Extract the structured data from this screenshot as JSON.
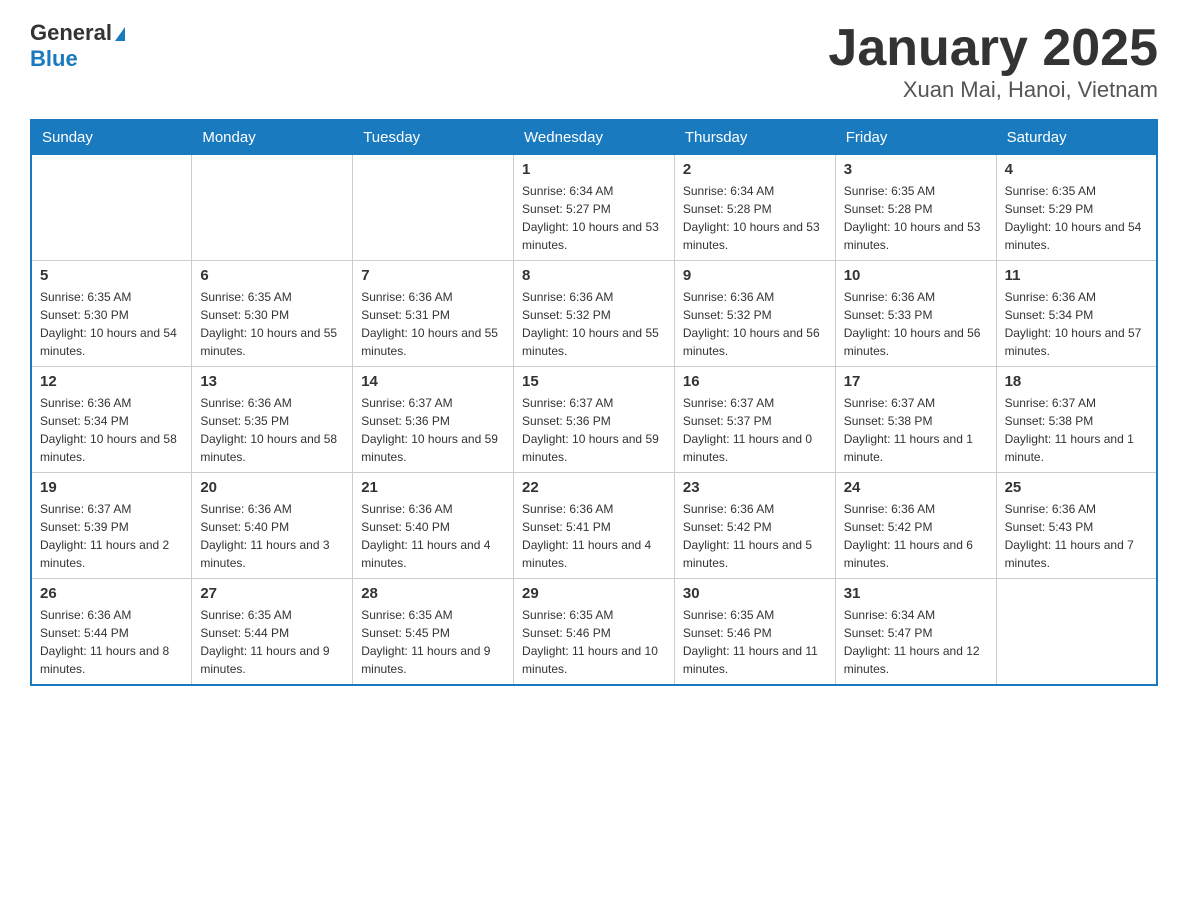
{
  "header": {
    "logo_general": "General",
    "logo_blue": "Blue",
    "title": "January 2025",
    "subtitle": "Xuan Mai, Hanoi, Vietnam"
  },
  "days_of_week": [
    "Sunday",
    "Monday",
    "Tuesday",
    "Wednesday",
    "Thursday",
    "Friday",
    "Saturday"
  ],
  "weeks": [
    {
      "days": [
        {
          "number": "",
          "info": ""
        },
        {
          "number": "",
          "info": ""
        },
        {
          "number": "",
          "info": ""
        },
        {
          "number": "1",
          "info": "Sunrise: 6:34 AM\nSunset: 5:27 PM\nDaylight: 10 hours and 53 minutes."
        },
        {
          "number": "2",
          "info": "Sunrise: 6:34 AM\nSunset: 5:28 PM\nDaylight: 10 hours and 53 minutes."
        },
        {
          "number": "3",
          "info": "Sunrise: 6:35 AM\nSunset: 5:28 PM\nDaylight: 10 hours and 53 minutes."
        },
        {
          "number": "4",
          "info": "Sunrise: 6:35 AM\nSunset: 5:29 PM\nDaylight: 10 hours and 54 minutes."
        }
      ]
    },
    {
      "days": [
        {
          "number": "5",
          "info": "Sunrise: 6:35 AM\nSunset: 5:30 PM\nDaylight: 10 hours and 54 minutes."
        },
        {
          "number": "6",
          "info": "Sunrise: 6:35 AM\nSunset: 5:30 PM\nDaylight: 10 hours and 55 minutes."
        },
        {
          "number": "7",
          "info": "Sunrise: 6:36 AM\nSunset: 5:31 PM\nDaylight: 10 hours and 55 minutes."
        },
        {
          "number": "8",
          "info": "Sunrise: 6:36 AM\nSunset: 5:32 PM\nDaylight: 10 hours and 55 minutes."
        },
        {
          "number": "9",
          "info": "Sunrise: 6:36 AM\nSunset: 5:32 PM\nDaylight: 10 hours and 56 minutes."
        },
        {
          "number": "10",
          "info": "Sunrise: 6:36 AM\nSunset: 5:33 PM\nDaylight: 10 hours and 56 minutes."
        },
        {
          "number": "11",
          "info": "Sunrise: 6:36 AM\nSunset: 5:34 PM\nDaylight: 10 hours and 57 minutes."
        }
      ]
    },
    {
      "days": [
        {
          "number": "12",
          "info": "Sunrise: 6:36 AM\nSunset: 5:34 PM\nDaylight: 10 hours and 58 minutes."
        },
        {
          "number": "13",
          "info": "Sunrise: 6:36 AM\nSunset: 5:35 PM\nDaylight: 10 hours and 58 minutes."
        },
        {
          "number": "14",
          "info": "Sunrise: 6:37 AM\nSunset: 5:36 PM\nDaylight: 10 hours and 59 minutes."
        },
        {
          "number": "15",
          "info": "Sunrise: 6:37 AM\nSunset: 5:36 PM\nDaylight: 10 hours and 59 minutes."
        },
        {
          "number": "16",
          "info": "Sunrise: 6:37 AM\nSunset: 5:37 PM\nDaylight: 11 hours and 0 minutes."
        },
        {
          "number": "17",
          "info": "Sunrise: 6:37 AM\nSunset: 5:38 PM\nDaylight: 11 hours and 1 minute."
        },
        {
          "number": "18",
          "info": "Sunrise: 6:37 AM\nSunset: 5:38 PM\nDaylight: 11 hours and 1 minute."
        }
      ]
    },
    {
      "days": [
        {
          "number": "19",
          "info": "Sunrise: 6:37 AM\nSunset: 5:39 PM\nDaylight: 11 hours and 2 minutes."
        },
        {
          "number": "20",
          "info": "Sunrise: 6:36 AM\nSunset: 5:40 PM\nDaylight: 11 hours and 3 minutes."
        },
        {
          "number": "21",
          "info": "Sunrise: 6:36 AM\nSunset: 5:40 PM\nDaylight: 11 hours and 4 minutes."
        },
        {
          "number": "22",
          "info": "Sunrise: 6:36 AM\nSunset: 5:41 PM\nDaylight: 11 hours and 4 minutes."
        },
        {
          "number": "23",
          "info": "Sunrise: 6:36 AM\nSunset: 5:42 PM\nDaylight: 11 hours and 5 minutes."
        },
        {
          "number": "24",
          "info": "Sunrise: 6:36 AM\nSunset: 5:42 PM\nDaylight: 11 hours and 6 minutes."
        },
        {
          "number": "25",
          "info": "Sunrise: 6:36 AM\nSunset: 5:43 PM\nDaylight: 11 hours and 7 minutes."
        }
      ]
    },
    {
      "days": [
        {
          "number": "26",
          "info": "Sunrise: 6:36 AM\nSunset: 5:44 PM\nDaylight: 11 hours and 8 minutes."
        },
        {
          "number": "27",
          "info": "Sunrise: 6:35 AM\nSunset: 5:44 PM\nDaylight: 11 hours and 9 minutes."
        },
        {
          "number": "28",
          "info": "Sunrise: 6:35 AM\nSunset: 5:45 PM\nDaylight: 11 hours and 9 minutes."
        },
        {
          "number": "29",
          "info": "Sunrise: 6:35 AM\nSunset: 5:46 PM\nDaylight: 11 hours and 10 minutes."
        },
        {
          "number": "30",
          "info": "Sunrise: 6:35 AM\nSunset: 5:46 PM\nDaylight: 11 hours and 11 minutes."
        },
        {
          "number": "31",
          "info": "Sunrise: 6:34 AM\nSunset: 5:47 PM\nDaylight: 11 hours and 12 minutes."
        },
        {
          "number": "",
          "info": ""
        }
      ]
    }
  ]
}
